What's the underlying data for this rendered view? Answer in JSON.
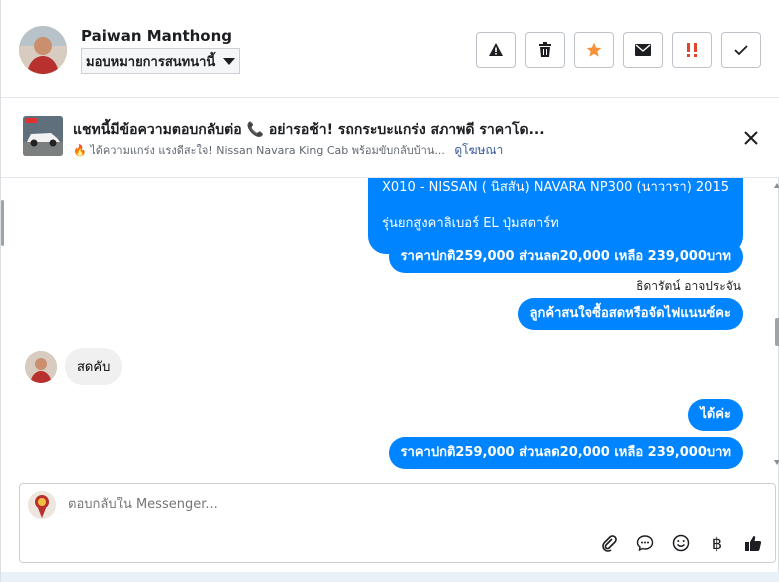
{
  "header": {
    "contact_name": "Paiwan Manthong",
    "assign_label": "มอบหมายการสนทนานี้",
    "actions": [
      {
        "icon": "warning-icon"
      },
      {
        "icon": "trash-icon"
      },
      {
        "icon": "star-icon",
        "color": "#f7923a"
      },
      {
        "icon": "mail-icon"
      },
      {
        "icon": "spam-icon",
        "color": "#e0452f"
      },
      {
        "icon": "check-icon"
      }
    ]
  },
  "ad_banner": {
    "title": "แชทนี้มีข้อความตอบกลับต่อ 📞 อย่ารอช้า! รถกระบะแกร่ง สภาพดี ราคาโด...",
    "subtitle": "🔥 ได้ความแกร่ง แรงดีสะใจ! Nissan Navara King Cab พร้อมขับกลับบ้าน...",
    "link": "ดูโฆษณา"
  },
  "messages": {
    "top_bubble_line1": "X010 - NISSAN ( นิสสัน) NAVARA NP300 (นาวารา) 2015",
    "top_bubble_line2": "รุ่นยกสูงคาลิเบอร์ EL ปุ่มสตาร์ท",
    "price_1": "ราคาปกติ259,000 ส่วนลด20,000 เหลือ 239,000บาท",
    "sender_name": "ธิดารัตน์ อาจประจัน",
    "question": "ลูกค้าสนใจซื้อสดหรือจัดไฟแนนซ์คะ",
    "incoming": "สดคับ",
    "reply": "ได้ค่ะ",
    "price_2": "ราคาปกติ259,000 ส่วนลด20,000 เหลือ 239,000บาท"
  },
  "composer": {
    "placeholder": "ตอบกลับใน Messenger...",
    "currency_symbol": "฿"
  },
  "colors": {
    "outgoing_bubble": "#0084ff",
    "incoming_bubble": "#f0f0f0",
    "link": "#385898"
  }
}
